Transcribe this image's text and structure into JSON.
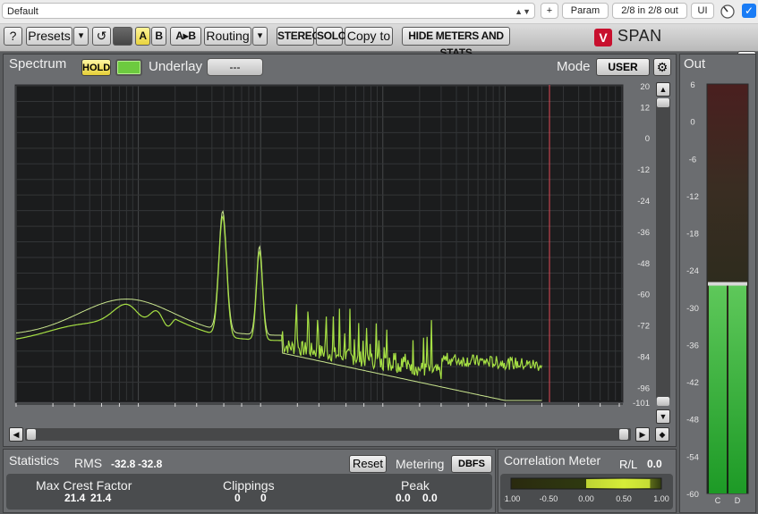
{
  "host": {
    "preset_name": "Default",
    "add_label": "+",
    "param_label": "Param",
    "io_label": "2/8 in 2/8 out",
    "ui_label": "UI",
    "check_mark": "✓"
  },
  "toolbar": {
    "help": "?",
    "presets": "Presets",
    "dropdown": "▾",
    "undo": "↺",
    "a": "A",
    "b": "B",
    "a_to_b": "A▸B",
    "routing": "Routing",
    "stereo": "STEREO",
    "solo": "SOLO",
    "copy_to": "Copy to",
    "hide_meters": "HIDE METERS AND STATS",
    "logo_mark": "V",
    "product": "SPAN"
  },
  "spectrum": {
    "title": "Spectrum",
    "hold": "HOLD",
    "underlay_label": "Underlay",
    "underlay_value": "---",
    "mode_label": "Mode",
    "mode_value": "USER",
    "gear": "⚙",
    "db_ticks": [
      "20",
      "12",
      "0",
      "-12",
      "-24",
      "-36",
      "-48",
      "-60",
      "-72",
      "-84",
      "-96",
      "-101"
    ],
    "freq_ticks": [
      "1",
      "2",
      "3",
      "5",
      "7",
      "10",
      "20",
      "30",
      "50",
      "70",
      "100",
      "200",
      "300",
      "500",
      "700",
      "1K",
      "2K",
      "3K",
      "5K",
      "7K",
      "10K",
      "20K",
      "40K",
      "60K",
      "92K"
    ],
    "colors": {
      "trace_bright": "#a8e24a",
      "trace_dim": "#c7e88f",
      "marker": "#e24a57",
      "grid": "#3b3d3f",
      "bg": "#191a1b"
    }
  },
  "statistics": {
    "title": "Statistics",
    "rms_label": "RMS",
    "rms_l": "-32.8",
    "rms_r": "-32.8",
    "reset": "Reset",
    "metering_label": "Metering",
    "metering_value": "DBFS",
    "crest_label": "Max Crest Factor",
    "crest_l": "21.4",
    "crest_r": "21.4",
    "clip_label": "Clippings",
    "clip_l": "0",
    "clip_r": "0",
    "peak_label": "Peak",
    "peak_l": "0.0",
    "peak_r": "0.0"
  },
  "correlation": {
    "title": "Correlation Meter",
    "rl_label": "R/L",
    "rl_value": "0.0",
    "scale": [
      "-1.00",
      "-0.50",
      "0.00",
      "0.50",
      "1.00"
    ],
    "value": 0.85
  },
  "out_meter": {
    "title": "Out",
    "scale": [
      "6",
      "0",
      "-6",
      "-12",
      "-18",
      "-24",
      "-30",
      "-36",
      "-42",
      "-48",
      "-54",
      "-60"
    ],
    "channels": [
      "C",
      "D"
    ],
    "level_db": -26.5
  }
}
